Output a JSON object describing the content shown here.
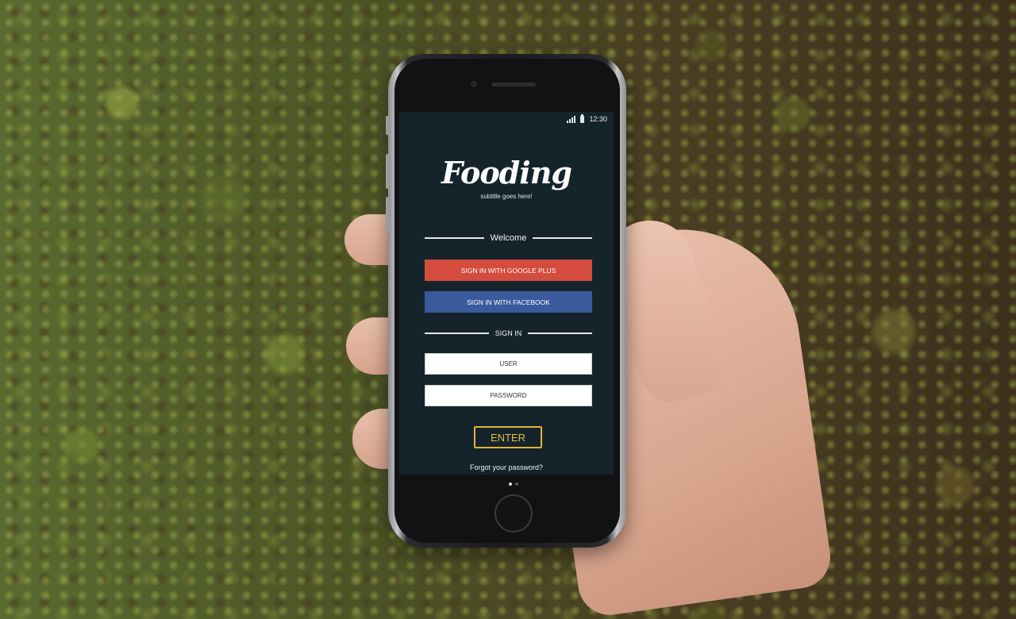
{
  "status_bar": {
    "time": "12:30",
    "icons": [
      "signal-icon",
      "battery-icon"
    ]
  },
  "app": {
    "title": "Fooding",
    "subtitle": "subtitle goes here!"
  },
  "welcome_label": "Welcome",
  "social": {
    "google_label": "SIGN IN WITH GOOGLE PLUS",
    "facebook_label": "SIGN IN WITH FACEBOOK"
  },
  "signin_label": "SIGN IN",
  "form": {
    "user_placeholder": "USER",
    "password_placeholder": "PASSWORD",
    "enter_label": "ENTER",
    "forgot_label": "Forgot your password?"
  },
  "colors": {
    "screen_bg": "#15242a",
    "google": "#d44c3e",
    "facebook": "#3b5a9c",
    "enter_accent": "#e2b23b"
  }
}
